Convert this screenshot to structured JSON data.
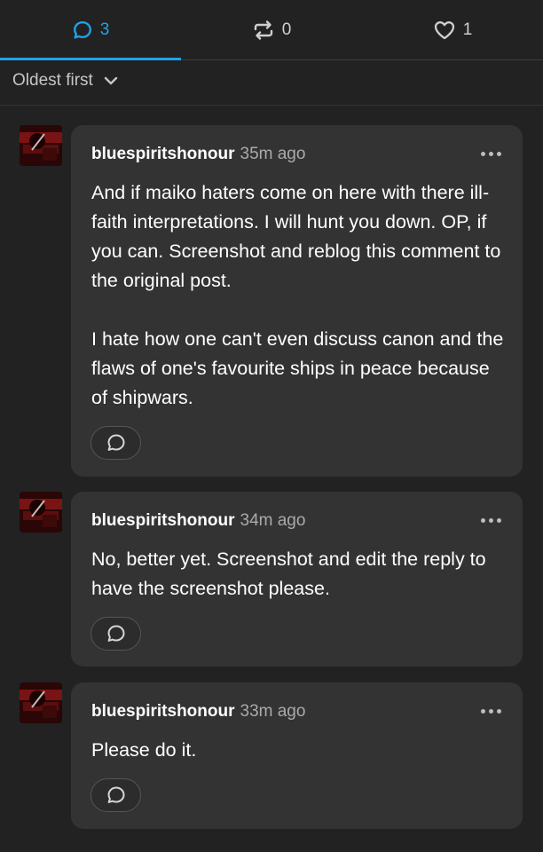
{
  "tabs": {
    "replies": {
      "count": "3",
      "icon": "chat-bubble-icon"
    },
    "reblogs": {
      "count": "0",
      "icon": "reblog-icon"
    },
    "likes": {
      "count": "1",
      "icon": "heart-icon"
    }
  },
  "sort": {
    "label": "Oldest first",
    "icon": "chevron-down-icon"
  },
  "comments": [
    {
      "username": "bluespiritshonour",
      "time": "35m ago",
      "paragraphs": [
        "And if maiko haters come on here with there ill-faith interpretations. I will hunt you down. OP, if you can. Screenshot and reblog this comment to the original post.",
        "I hate how one can't even discuss canon and the flaws of one's favourite ships in peace because of shipwars."
      ]
    },
    {
      "username": "bluespiritshonour",
      "time": "34m ago",
      "paragraphs": [
        "No, better yet. Screenshot and edit the reply to have the screenshot please."
      ]
    },
    {
      "username": "bluespiritshonour",
      "time": "33m ago",
      "paragraphs": [
        "Please do it."
      ]
    }
  ],
  "colors": {
    "accent": "#1ea3e6",
    "background": "#222222",
    "bubble": "#333333"
  }
}
